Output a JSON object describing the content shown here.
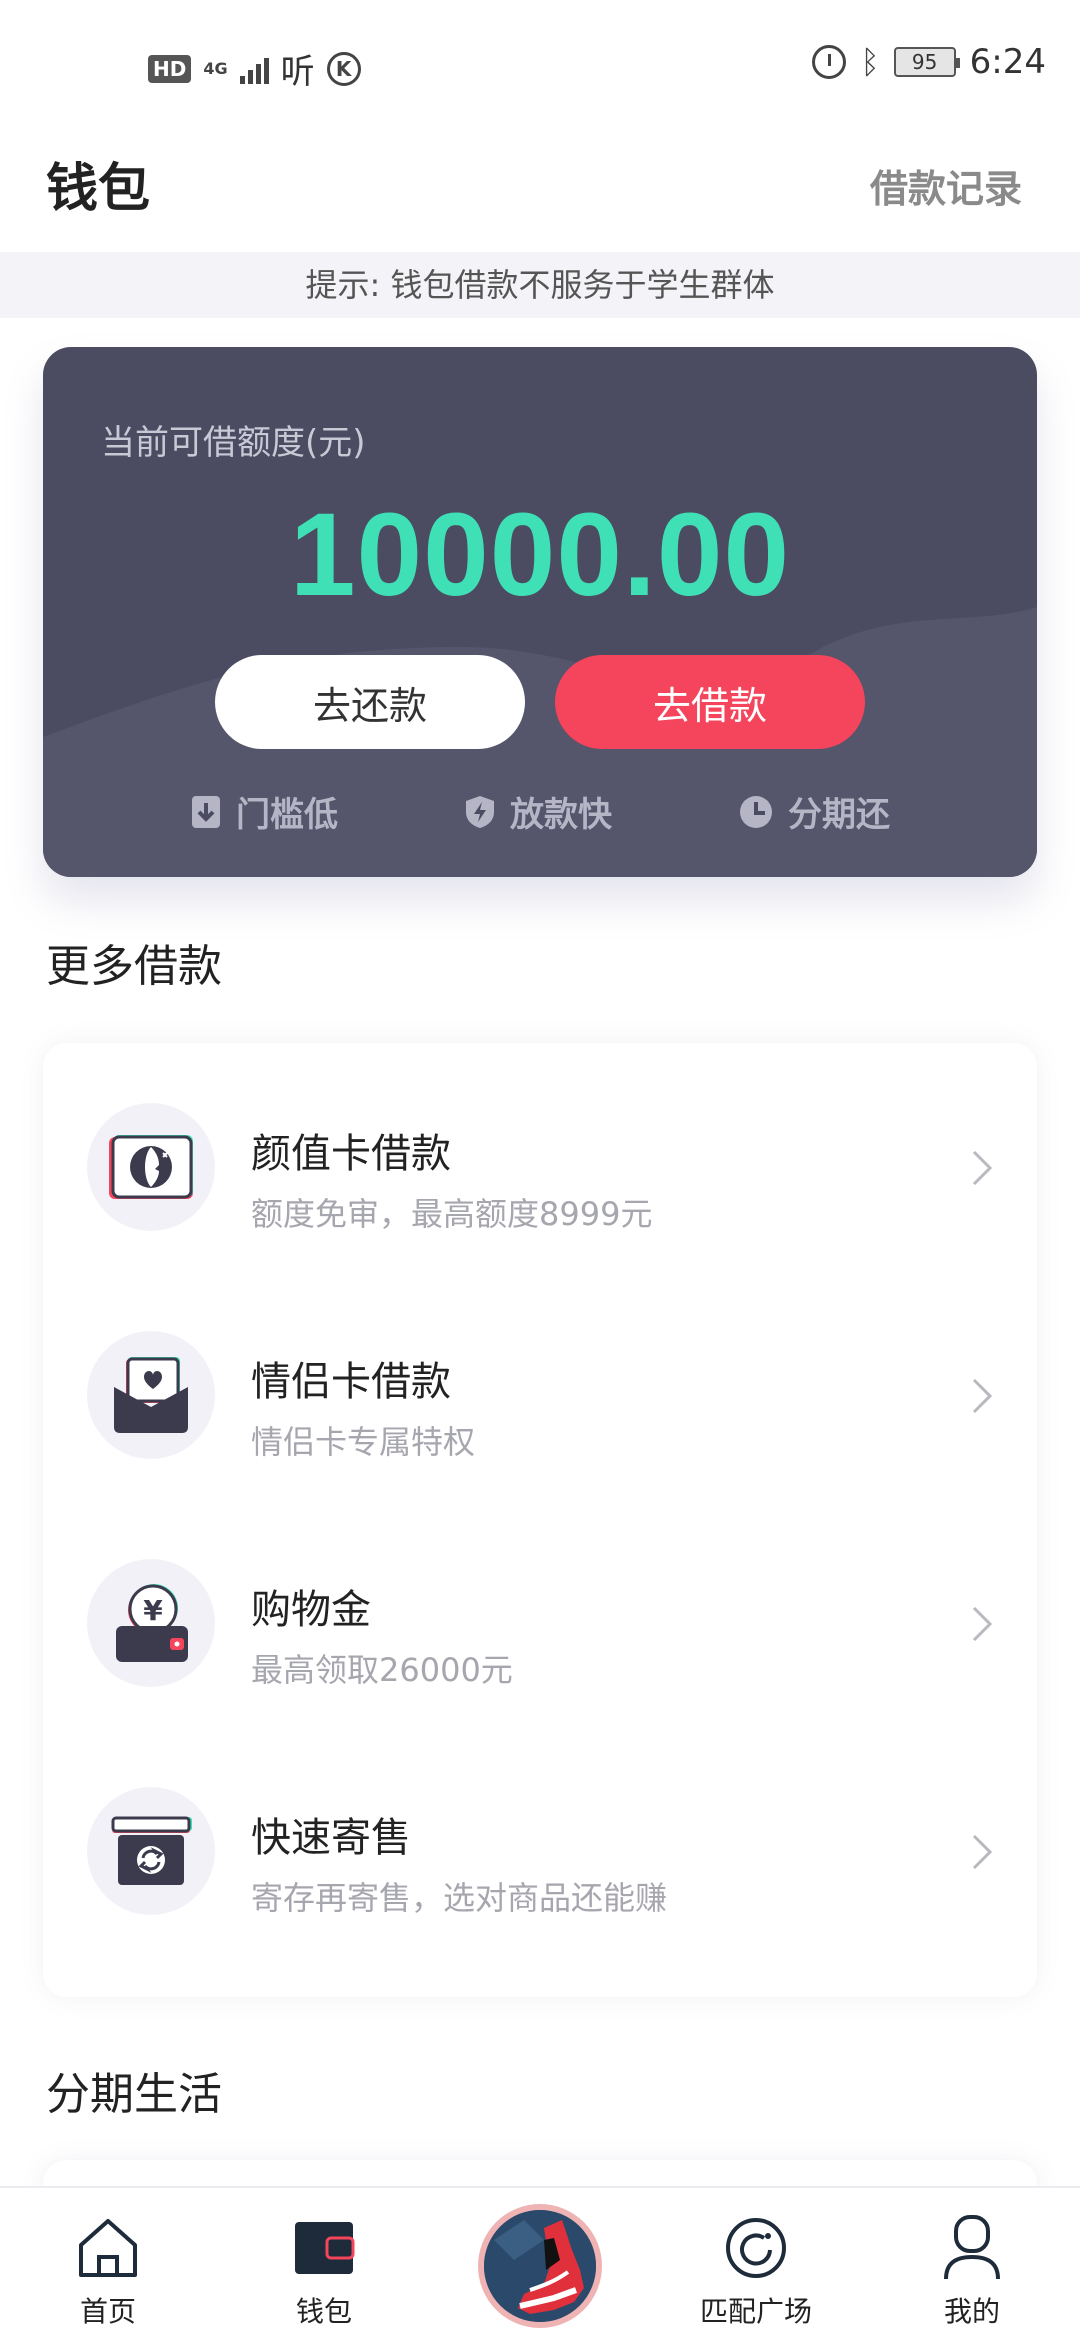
{
  "status_bar": {
    "hd": "HD",
    "network": "4G",
    "ting": "听",
    "k": "K",
    "battery": "95",
    "time": "6:24"
  },
  "header": {
    "title": "钱包",
    "loan_record": "借款记录"
  },
  "notice": "提示: 钱包借款不服务于学生群体",
  "credit": {
    "label": "当前可借额度(元)",
    "amount": "10000.00",
    "repay_button": "去还款",
    "borrow_button": "去借款",
    "features": [
      {
        "label": "门槛低",
        "icon": "download-icon"
      },
      {
        "label": "放款快",
        "icon": "shield-bolt-icon"
      },
      {
        "label": "分期还",
        "icon": "clock-icon"
      }
    ],
    "accent_color": "#3fe0b6",
    "primary_color": "#f5455c"
  },
  "more_loans": {
    "title": "更多借款",
    "items": [
      {
        "name": "颜值卡借款",
        "desc": "额度免审，最高额度8999元",
        "icon": "face-card-icon"
      },
      {
        "name": "情侣卡借款",
        "desc": "情侣卡专属特权",
        "icon": "couple-card-icon"
      },
      {
        "name": "购物金",
        "desc": "最高领取26000元",
        "icon": "wallet-yuan-icon"
      },
      {
        "name": "快速寄售",
        "desc": "寄存再寄售，选对商品还能赚",
        "icon": "consign-box-icon"
      }
    ]
  },
  "installment": {
    "title": "分期生活"
  },
  "bottom_nav": {
    "items": [
      {
        "label": "首页",
        "icon": "home-icon"
      },
      {
        "label": "钱包",
        "icon": "wallet-icon"
      },
      {
        "label": "",
        "icon": "sneaker-icon"
      },
      {
        "label": "匹配广场",
        "icon": "match-icon"
      },
      {
        "label": "我的",
        "icon": "user-icon"
      }
    ]
  }
}
